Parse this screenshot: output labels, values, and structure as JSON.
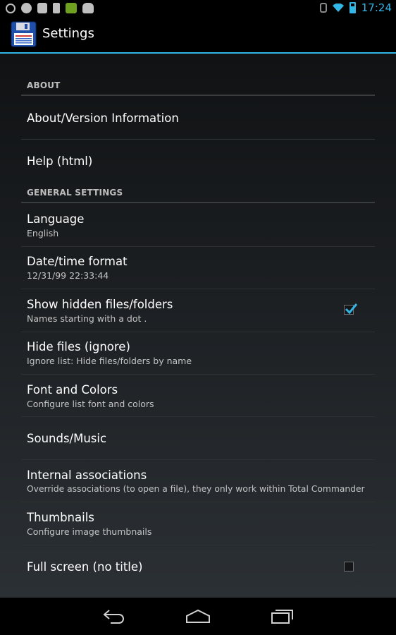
{
  "status_bar": {
    "time": "17:24",
    "left_icons": [
      "sync-icon",
      "adblock-icon",
      "app-icon-grid",
      "phone-icon",
      "battery-app-icon",
      "android-icon"
    ],
    "right_icons": [
      "bluetooth-icon",
      "wifi-icon",
      "battery-icon"
    ]
  },
  "action_bar": {
    "title": "Settings",
    "icon": "floppy-disk-icon"
  },
  "sections": {
    "about": {
      "header": "ABOUT",
      "items": [
        {
          "title": "About/Version Information"
        },
        {
          "title": "Help (html)"
        }
      ]
    },
    "general": {
      "header": "GENERAL SETTINGS",
      "items": [
        {
          "title": "Language",
          "summary": "English"
        },
        {
          "title": "Date/time format",
          "summary": "12/31/99  22:33:44"
        },
        {
          "title": "Show hidden files/folders",
          "summary": "Names starting with a dot .",
          "checked": true
        },
        {
          "title": "Hide files (ignore)",
          "summary": "Ignore list: Hide files/folders by name"
        },
        {
          "title": "Font and Colors",
          "summary": "Configure list font and colors"
        },
        {
          "title": "Sounds/Music"
        },
        {
          "title": "Internal associations",
          "summary": "Override associations (to open a file), they only work within Total Commander"
        },
        {
          "title": "Thumbnails",
          "summary": "Configure image thumbnails"
        },
        {
          "title": "Full screen (no title)",
          "checked": false
        }
      ]
    }
  },
  "colors": {
    "accent": "#33b5e5",
    "background_top": "#101214",
    "background_bottom": "#2b3034",
    "summary_text": "#c4c4c4"
  },
  "nav_bar": {
    "buttons": [
      "back-icon",
      "home-icon",
      "recent-apps-icon"
    ]
  }
}
